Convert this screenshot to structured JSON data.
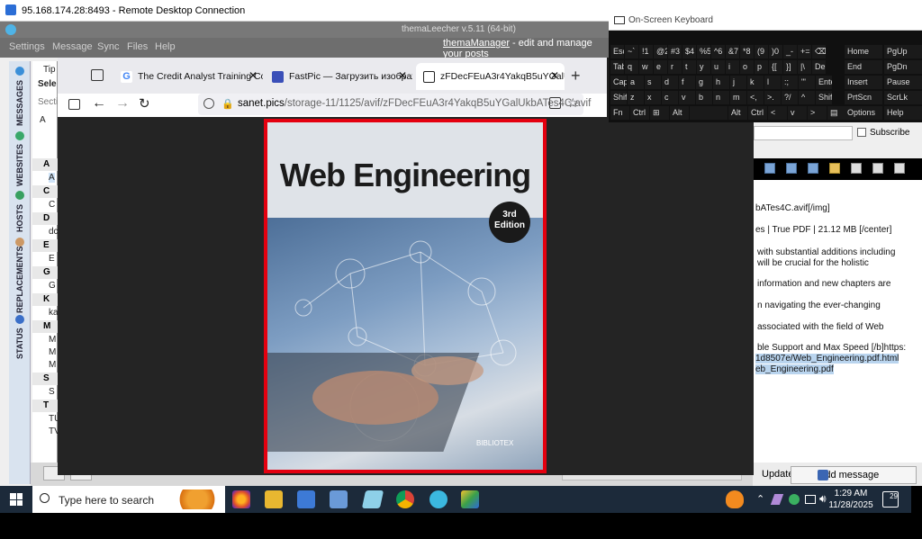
{
  "rdp": {
    "title": "95.168.174.28:8493 - Remote Desktop Connection"
  },
  "thema": {
    "title": "themaLeecher v.5.11  (64-bit)",
    "menu": [
      "Settings",
      "Message",
      "Sync",
      "Files",
      "Help"
    ],
    "manager_link": "themaManager",
    "manager_text": " - edit and manage your posts",
    "side_tabs": [
      "MESSAGES",
      "WEBSITES",
      "HOSTS",
      "REPLACEMENTS",
      "STATUS"
    ],
    "left_fragments": [
      "Tip",
      "Sele",
      "Secti",
      "A"
    ],
    "list_letters": [
      "A",
      "C",
      "D",
      "E",
      "G",
      "K",
      "M",
      "S",
      "T"
    ],
    "list_fragments": [
      "A",
      "C",
      "dc",
      "E",
      "G",
      "ka",
      "M",
      "M",
      "M",
      "S",
      "TU",
      "TV"
    ],
    "subscribe": "Subscribe",
    "right_text": [
      "bATes4C.avif[/img]",
      "es | True PDF | 21.12 MB [/center]",
      "with substantial additions including",
      "will be crucial for the holistic",
      "information and new chapters are",
      "n navigating the ever-changing",
      "associated with the field of Web",
      "ble Support and Max Speed [/b]https:",
      "1d8507e/Web_Engineering.pdf.html",
      "eb_Engineering.pdf"
    ],
    "update_btn": "Update",
    "add_message_btn": "Add message"
  },
  "browser": {
    "tabs": [
      {
        "label": "The Credit Analyst Training Cou",
        "favicon_color": "#ffffff"
      },
      {
        "label": "FastPic — Загрузить изображе",
        "favicon_color": "#3a4fb8"
      },
      {
        "label": "zFDecFEuA3r4YakqB5uYGalUkb",
        "favicon_color": "#222222"
      }
    ],
    "url_host": "sanet.pics",
    "url_path": "/storage-11/1125/avif/zFDecFEuA3r4YakqB5uYGalUkbATes4C.avif",
    "new_tab": "+"
  },
  "cover": {
    "title": "Web Engineering",
    "edition": "3rd\nEdition",
    "publisher": "BIBLIOTEX",
    "border_color": "#e4000f"
  },
  "osk": {
    "title": "On-Screen Keyboard",
    "rows": [
      [
        "Esc",
        "~`",
        "!1",
        "@2",
        "#3",
        "$4",
        "%5",
        "^6",
        "&7",
        "*8",
        "(9",
        ")0",
        "_-",
        "+=",
        "⌫",
        "Home",
        "PgUp"
      ],
      [
        "Tab",
        "q",
        "w",
        "e",
        "r",
        "t",
        "y",
        "u",
        "i",
        "o",
        "p",
        "{[",
        "}]",
        "|\\",
        "Del",
        "End",
        "PgDn"
      ],
      [
        "Caps",
        "a",
        "s",
        "d",
        "f",
        "g",
        "h",
        "j",
        "k",
        "l",
        ":;",
        "\"'",
        "Enter",
        "Insert",
        "Pause"
      ],
      [
        "Shift",
        "z",
        "x",
        "c",
        "v",
        "b",
        "n",
        "m",
        "<,",
        ">.",
        "?/",
        "^",
        "Shift",
        "PrtScn",
        "ScrLk"
      ],
      [
        "Fn",
        "Ctrl",
        "⊞",
        "Alt",
        "",
        "Alt",
        "Ctrl",
        "<",
        "v",
        ">",
        "▤",
        "Options",
        "Help"
      ]
    ]
  },
  "taskbar": {
    "search_placeholder": "Type here to search",
    "time": "1:29 AM",
    "date": "11/28/2025",
    "notifications": "29"
  }
}
